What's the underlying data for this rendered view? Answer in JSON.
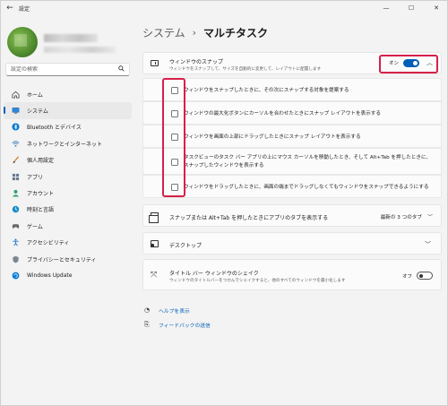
{
  "window": {
    "title": "設定",
    "back_glyph": "←"
  },
  "sidebar": {
    "search_placeholder": "設定の検索",
    "items": [
      {
        "label": "ホーム",
        "icon": "home-icon"
      },
      {
        "label": "システム",
        "icon": "system-icon",
        "active": true
      },
      {
        "label": "Bluetooth とデバイス",
        "icon": "bluetooth-icon"
      },
      {
        "label": "ネットワークとインターネット",
        "icon": "network-icon"
      },
      {
        "label": "個人用設定",
        "icon": "personalization-icon"
      },
      {
        "label": "アプリ",
        "icon": "apps-icon"
      },
      {
        "label": "アカウント",
        "icon": "account-icon"
      },
      {
        "label": "時刻と言語",
        "icon": "time-language-icon"
      },
      {
        "label": "ゲーム",
        "icon": "gaming-icon"
      },
      {
        "label": "アクセシビリティ",
        "icon": "accessibility-icon"
      },
      {
        "label": "プライバシーとセキュリティ",
        "icon": "privacy-icon"
      },
      {
        "label": "Windows Update",
        "icon": "windows-update-icon"
      }
    ]
  },
  "breadcrumb": {
    "parent": "システム",
    "separator": "›",
    "current": "マルチタスク"
  },
  "snap": {
    "title": "ウィンドウのスナップ",
    "description": "ウィンドウをスナップして、サイズを自動的に変更して、レイアウトに配置します",
    "toggle_label": "オン",
    "toggle_on": true,
    "options": [
      "ウィンドウをスナップしたときに、その次にスナップする対象を提案する",
      "ウィンドウの最大化ボタンにカーソルを合わせたときにスナップ レイアウトを表示する",
      "ウィンドウを画面の上部にドラッグしたときにスナップ レイアウトを表示する",
      "タスクビューのタスク バー アプリの上にマウス カーソルを移動したとき、そして Alt+Tab を押したときに、",
      "スナップしたウィンドウを表示する",
      "ウィンドウをドラッグしたときに、画面の端までドラッグしなくてもウィンドウをスナップできるようにする"
    ]
  },
  "alt_tab": {
    "title": "スナップまたは Alt+Tab を押したときにアプリのタブを表示する",
    "value": "最新の 3 つのタブ"
  },
  "desktops": {
    "title": "デスクトップ"
  },
  "shake": {
    "title": "タイトル バー ウィンドウのシェイク",
    "description": "ウィンドウのタイトルバーをつかんでシェイクすると、他のすべてのウィンドウを最小化します",
    "toggle_label": "オフ",
    "toggle_on": false
  },
  "links": {
    "help": "ヘルプを表示",
    "feedback": "フィードバックの送信"
  },
  "colors": {
    "accent": "#005fb8",
    "highlight": "#d6204a"
  }
}
